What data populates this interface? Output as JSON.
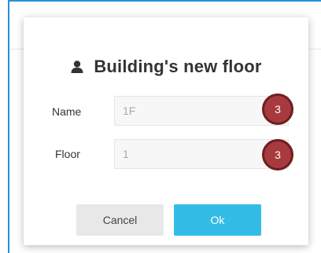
{
  "dialog": {
    "title": "Building's new floor",
    "icon": "user-icon"
  },
  "fields": {
    "name": {
      "label": "Name",
      "value": "1F",
      "badge": "3"
    },
    "floor": {
      "label": "Floor",
      "value": "1",
      "badge": "3"
    }
  },
  "buttons": {
    "cancel_label": "Cancel",
    "ok_label": "Ok"
  },
  "colors": {
    "accent_frame": "#2a8fd8",
    "ok_button": "#33bde6",
    "cancel_button": "#e8e8e8",
    "badge": "#a83a3e"
  }
}
